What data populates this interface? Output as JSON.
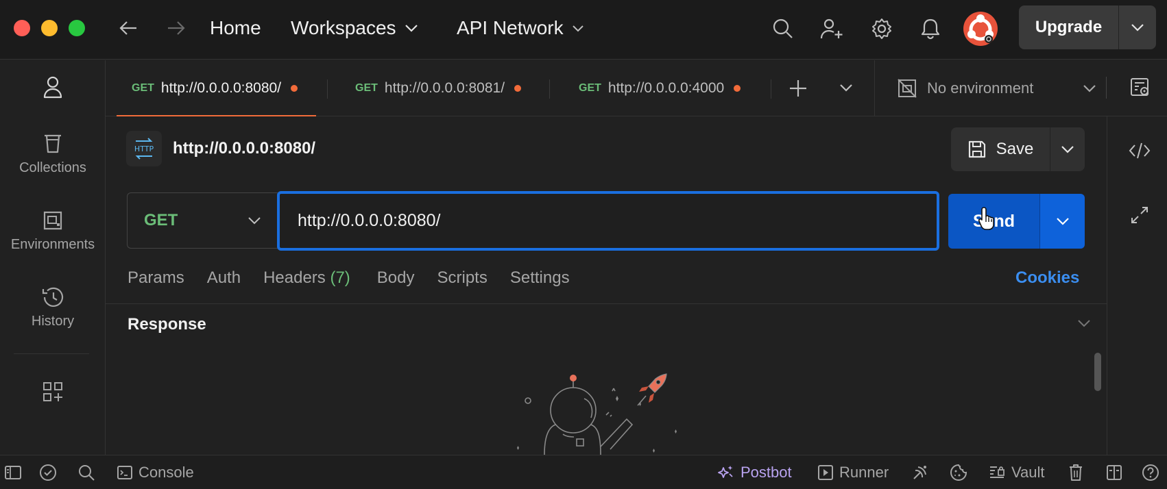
{
  "topbar": {
    "traffic_lights": {
      "close": "#ff5f57",
      "minimize": "#febc2e",
      "maximize": "#28c840"
    },
    "nav": [
      {
        "label": "Home"
      },
      {
        "label": "Workspaces"
      },
      {
        "label": "API Network"
      }
    ],
    "upgrade_label": "Upgrade"
  },
  "sidebar": {
    "items": [
      {
        "label": "",
        "icon": "user-icon"
      },
      {
        "label": "Collections",
        "icon": "trash-bin-icon"
      },
      {
        "label": "Environments",
        "icon": "environment-icon"
      },
      {
        "label": "History",
        "icon": "history-icon"
      },
      {
        "label": "",
        "icon": "add-grid-icon"
      }
    ]
  },
  "tabs": [
    {
      "method": "GET",
      "url": "http://0.0.0.0:8080/",
      "unsaved": true,
      "active": true
    },
    {
      "method": "GET",
      "url": "http://0.0.0.0:8081/",
      "unsaved": true,
      "active": false
    },
    {
      "method": "GET",
      "url": "http://0.0.0.0:4000",
      "unsaved": true,
      "active": false
    }
  ],
  "environment": {
    "label": "No environment"
  },
  "request": {
    "title": "http://0.0.0.0:8080/",
    "badge": "HTTP",
    "save_label": "Save",
    "method": "GET",
    "url": "http://0.0.0.0:8080/",
    "send_label": "Send",
    "subtabs": [
      {
        "label": "Params"
      },
      {
        "label": "Auth"
      },
      {
        "label": "Headers",
        "count": "(7)"
      },
      {
        "label": "Body"
      },
      {
        "label": "Scripts"
      },
      {
        "label": "Settings"
      }
    ],
    "cookies_label": "Cookies"
  },
  "response": {
    "label": "Response"
  },
  "statusbar": {
    "console_label": "Console",
    "postbot_label": "Postbot",
    "runner_label": "Runner",
    "vault_label": "Vault"
  },
  "colors": {
    "accent_orange": "#f26b3a",
    "method_green": "#6bbd78",
    "send_blue": "#0b56c4",
    "link_blue": "#3b8ef0"
  }
}
